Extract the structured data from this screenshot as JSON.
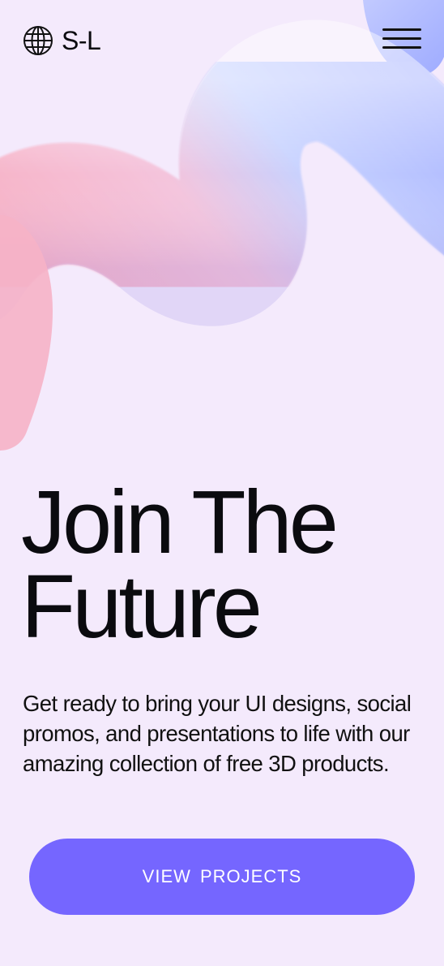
{
  "header": {
    "brand_name": "S-L",
    "brand_icon": "globe-icon",
    "menu_icon": "hamburger-menu-icon"
  },
  "hero": {
    "headline_line1": "Join The",
    "headline_line2": "Future",
    "subcopy": "Get ready to bring your UI designs, social promos, and presentations to life with our amazing collection of free 3D products.",
    "cta_label": "VIEW  PROJECTS"
  },
  "colors": {
    "background": "#f4eafc",
    "accent": "#7566ff",
    "text": "#0b0b0f",
    "shape_pink": "#f6b0c8",
    "shape_blue": "#b9c7ff"
  }
}
